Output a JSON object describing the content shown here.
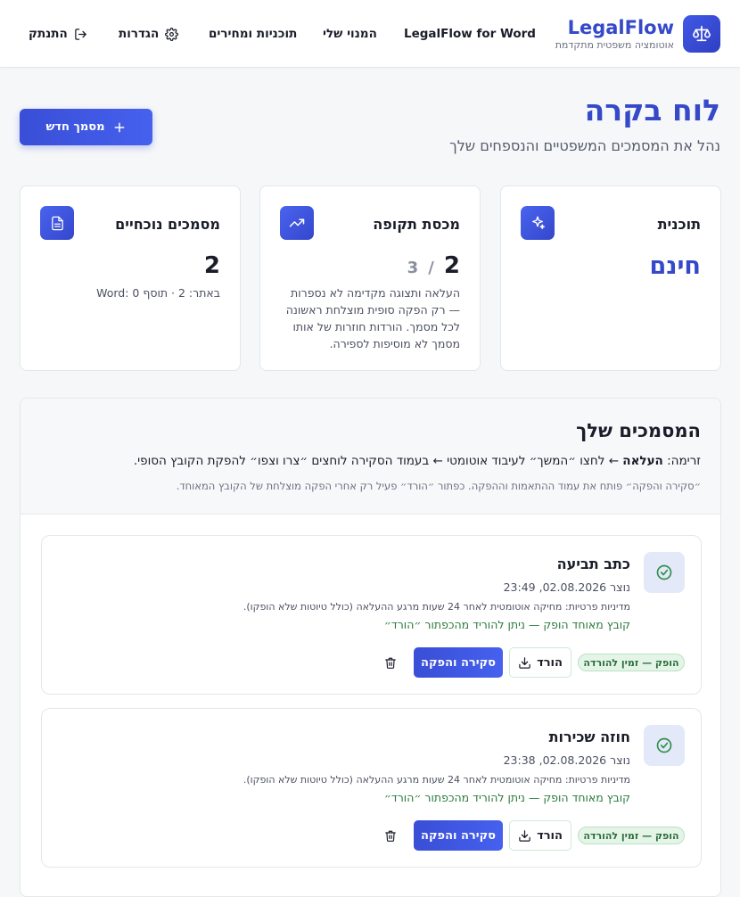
{
  "header": {
    "brand_name": "LegalFlow",
    "brand_tagline": "אוטומציה משפטית מתקדמת",
    "nav": {
      "word": "LegalFlow for Word",
      "subscription": "המנוי שלי",
      "plans": "תוכניות ומחירים",
      "settings": "הגדרות",
      "logout": "התנתק"
    }
  },
  "hero": {
    "title": "לוח בקרה",
    "subtitle": "נהל את המסמכים המשפטיים והנספחים שלך",
    "new_doc_label": "מסמך חדש"
  },
  "stats": {
    "plan": {
      "title": "תוכנית",
      "value": "חינם"
    },
    "quota": {
      "title": "מכסת תקופה",
      "used": "2",
      "separator": "/",
      "total": "3",
      "description": "העלאה ותצוגה מקדימה לא נספרות — רק הפקה סופית מוצלחת ראשונה לכל מסמך. הורדות חוזרות של אותו מסמך לא מוסיפות לספירה."
    },
    "current": {
      "title": "מסמכים נוכחיים",
      "value": "2",
      "breakdown": "באתר: 2 · תוסף Word: 0"
    }
  },
  "documents": {
    "title": "המסמכים שלך",
    "flow_prefix": "זרימה: ",
    "flow_upload": "העלאה",
    "flow_rest": " ← לחצו ״המשך״ לעיבוד אוטומטי ← בעמוד הסקירה לוחצים ״צרו וצפו״ להפקת הקובץ הסופי.",
    "note": "״סקירה והפקה״ פותח את עמוד ההתאמות וההפקה. כפתור ״הורד״ פעיל רק אחרי הפקה מוצלחת של הקובץ המאוחד.",
    "items": [
      {
        "title": "כתב תביעה",
        "created": "נוצר 02.08.2026, 23:49",
        "privacy": "מדיניות פרטיות: מחיקה אוטומטית לאחר 24 שעות מרגע ההעלאה (כולל טיוטות שלא הופקו).",
        "ready": "קובץ מאוחד הופק — ניתן להוריד מהכפתור ״הורד״",
        "status": "הופק — זמין להורדה",
        "download_label": "הורד",
        "review_label": "סקירה והפקה"
      },
      {
        "title": "חוזה שכירות",
        "created": "נוצר 02.08.2026, 23:38",
        "privacy": "מדיניות פרטיות: מחיקה אוטומטית לאחר 24 שעות מרגע ההעלאה (כולל טיוטות שלא הופקו).",
        "ready": "קובץ מאוחד הופק — ניתן להוריד מהכפתור ״הורד״",
        "status": "הופק — זמין להורדה",
        "download_label": "הורד",
        "review_label": "סקירה והפקה"
      }
    ]
  },
  "colors": {
    "accent": "#3549c9",
    "success": "#2b7a3d",
    "badge_bg": "#e4f5e8"
  }
}
